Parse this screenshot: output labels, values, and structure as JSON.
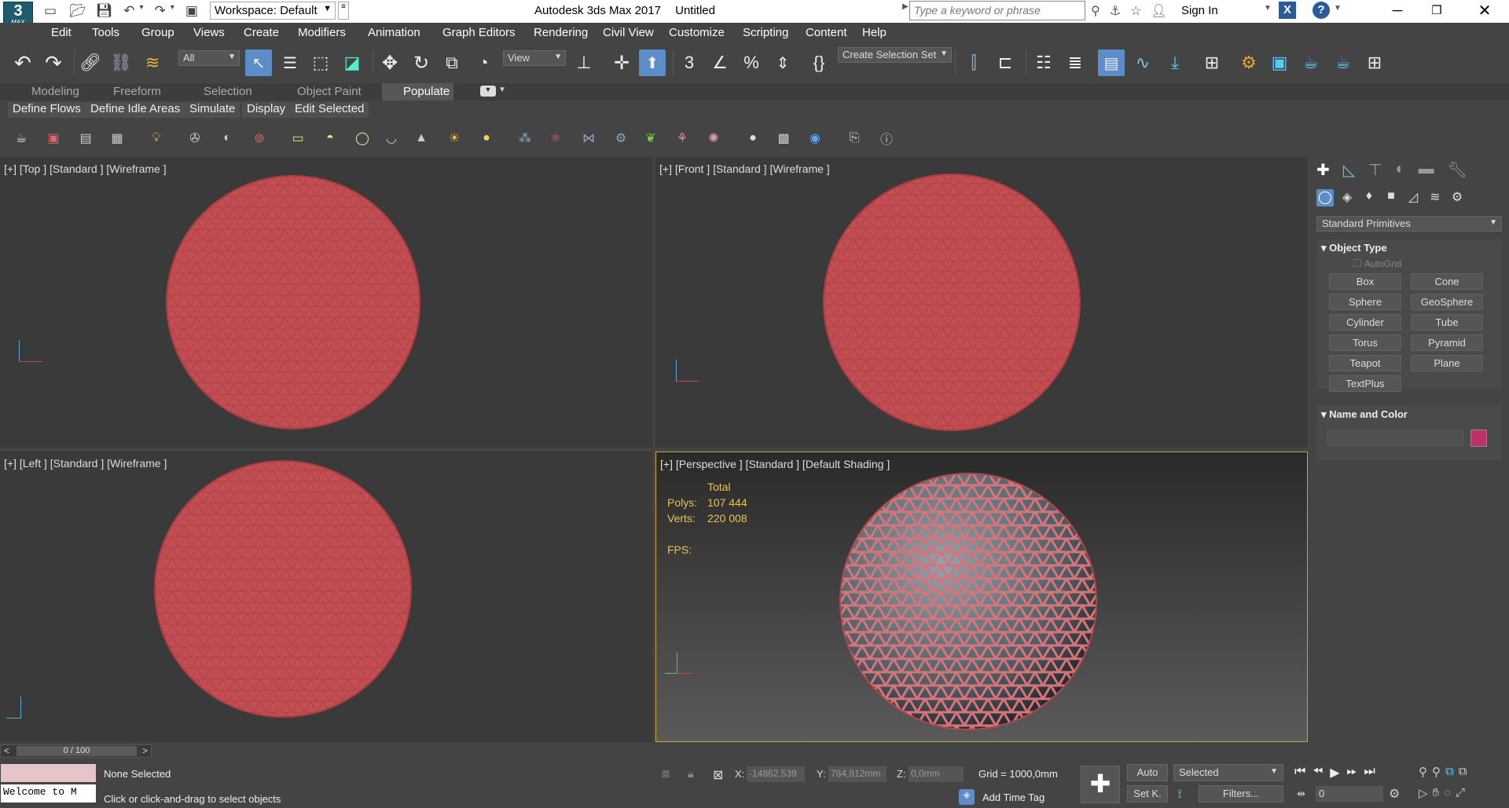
{
  "titlebar": {
    "app_badge": "3",
    "app_badge_sub": "MAX",
    "workspace": "Workspace: Default",
    "title": "Autodesk 3ds Max 2017",
    "document": "Untitled",
    "search_placeholder": "Type a keyword or phrase",
    "sign_in": "Sign In"
  },
  "menu": [
    "Edit",
    "Tools",
    "Group",
    "Views",
    "Create",
    "Modifiers",
    "Animation",
    "Graph Editors",
    "Rendering",
    "Civil View",
    "Customize",
    "Scripting",
    "Content",
    "Help"
  ],
  "toolbar": {
    "filter": "All",
    "refcoord": "View",
    "selection_set": "Create Selection Set"
  },
  "ribbon": {
    "tabs": [
      "Modeling",
      "Freeform",
      "Selection",
      "Object Paint",
      "Populate"
    ],
    "active_tab": "Populate",
    "row_buttons": [
      "Define Flows",
      "Define Idle Areas",
      "Simulate",
      "Display",
      "Edit Selected"
    ]
  },
  "viewports": {
    "top": "[+] [Top ] [Standard ] [Wireframe ]",
    "front": "[+] [Front ] [Standard ] [Wireframe ]",
    "left": "[+] [Left ] [Standard ] [Wireframe ]",
    "perspective": "[+] [Perspective ] [Standard ] [Default Shading ]",
    "stats": {
      "total_label": "Total",
      "polys_label": "Polys:",
      "polys_value": "107 444",
      "verts_label": "Verts:",
      "verts_value": "220 008",
      "fps_label": "FPS:"
    }
  },
  "command_panel": {
    "category": "Standard Primitives",
    "object_type_title": "Object Type",
    "autogrid": "AutoGrid",
    "buttons": [
      "Box",
      "Cone",
      "Sphere",
      "GeoSphere",
      "Cylinder",
      "Tube",
      "Torus",
      "Pyramid",
      "Teapot",
      "Plane",
      "TextPlus"
    ],
    "name_color_title": "Name and Color",
    "name_value": "",
    "color": "#c0306a"
  },
  "status": {
    "time_slider": "0 / 100",
    "listener": "Welcome to M",
    "selection": "None Selected",
    "prompt": "Click or click-and-drag to select objects",
    "x_label": "X:",
    "x_value": "-14862,539",
    "y_label": "Y:",
    "y_value": "784,812mm",
    "z_label": "Z:",
    "z_value": "0,0mm",
    "grid": "Grid = 1000,0mm",
    "add_time_tag": "Add Time Tag",
    "auto": "Auto",
    "set_key": "Set K.",
    "selected": "Selected",
    "filters": "Filters...",
    "frame": "0"
  },
  "colors": {
    "viewport_bg": "#3a3a3a",
    "wire": "#c8464a",
    "active_border": "#c9a43c",
    "stats_text": "#e8c454"
  }
}
